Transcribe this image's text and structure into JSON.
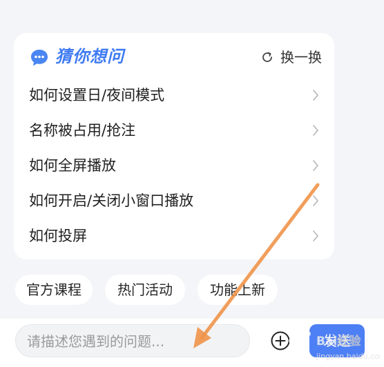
{
  "faq_card": {
    "title": "猜你想问",
    "refresh_label": "换一换",
    "items": [
      {
        "label": "如何设置日/夜间模式"
      },
      {
        "label": "名称被占用/抢注"
      },
      {
        "label": "如何全屏播放"
      },
      {
        "label": "如何开启/关闭小窗口播放"
      },
      {
        "label": "如何投屏"
      }
    ]
  },
  "quick_tags": [
    {
      "label": "官方课程"
    },
    {
      "label": "热门活动"
    },
    {
      "label": "功能上新"
    }
  ],
  "composer": {
    "placeholder": "请描述您遇到的问题...",
    "send_label": "发送"
  },
  "watermark": {
    "brand": "Baidu经验",
    "sub": "jingyan.baidu.com"
  },
  "colors": {
    "accent": "#3f7bf2",
    "send_button": "#4d7ff5",
    "annotation_arrow": "#f0944a"
  },
  "icons": {
    "title_icon": "chat-bubble-icon",
    "refresh_icon": "refresh-icon",
    "item_icon": "chevron-right-icon",
    "add_icon": "plus-circle-icon"
  }
}
